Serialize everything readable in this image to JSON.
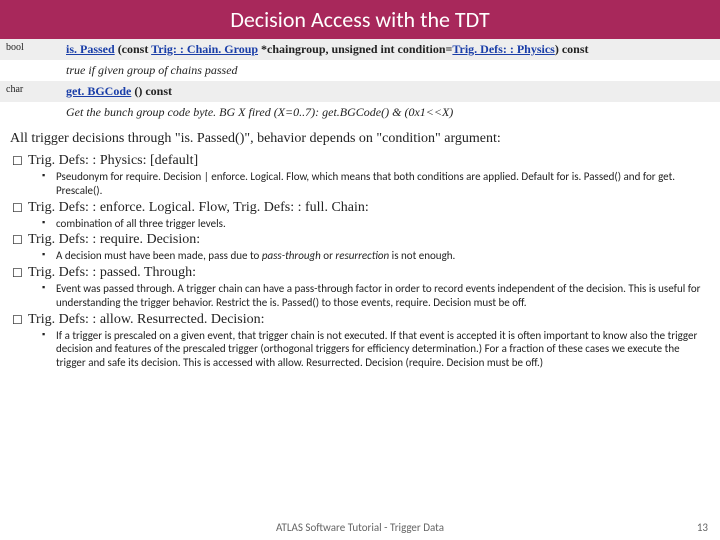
{
  "title_html": "Decision Access with the TDT",
  "api": [
    {
      "ret": "bool",
      "sig_parts": [
        "is. Passed",
        " (const ",
        "Trig: : Chain. Group",
        " *chaingroup, unsigned int condition=",
        "Trig. Defs: : Physics",
        ") const"
      ],
      "links": [
        0,
        2,
        4
      ],
      "desc": "true if given group of chains passed"
    },
    {
      "ret": "char",
      "sig_parts": [
        "get. BGCode",
        " () const"
      ],
      "links": [
        0
      ],
      "desc": "Get the bunch group code byte. BG X fired (X=0..7): get.BGCode() & (0x1<<X)"
    }
  ],
  "intro": "All trigger decisions through \"is. Passed()\", behavior depends on \"condition\" argument:",
  "items": [
    {
      "title": "Trig. Defs: : Physics: [default]",
      "bullets": [
        "Pseudonym for require. Decision | enforce. Logical. Flow, which means that both conditions are applied. Default for is. Passed() and for get. Prescale()."
      ]
    },
    {
      "title": "Trig. Defs: : enforce. Logical. Flow, Trig. Defs: : full. Chain:",
      "bullets": [
        "combination of all three trigger levels."
      ]
    },
    {
      "title": "Trig. Defs: : require. Decision:",
      "bullets": [
        "A decision must have been made, pass due to <em>pass-through</em> or <em>resurrection</em> is not enough."
      ]
    },
    {
      "title": "Trig. Defs: : passed. Through:",
      "bullets": [
        "Event was passed through. A trigger chain can have a pass-through factor in order to record events independent of the decision. This is useful for understanding the trigger behavior. Restrict the is. Passed() to those events, require. Decision must be off."
      ]
    },
    {
      "title": "Trig. Defs: : allow. Resurrected. Decision:",
      "bullets": [
        "If a trigger is prescaled on a given event, that trigger chain is not executed. If that event is accepted it is often important to know also the trigger decision and features of the prescaled trigger (orthogonal triggers for efficiency determination.) For a fraction of these cases we execute the trigger and safe its decision. This is accessed with allow. Resurrected. Decision (require. Decision must be off.)"
      ]
    }
  ],
  "footer": "ATLAS Software Tutorial - Trigger Data",
  "page": "13"
}
